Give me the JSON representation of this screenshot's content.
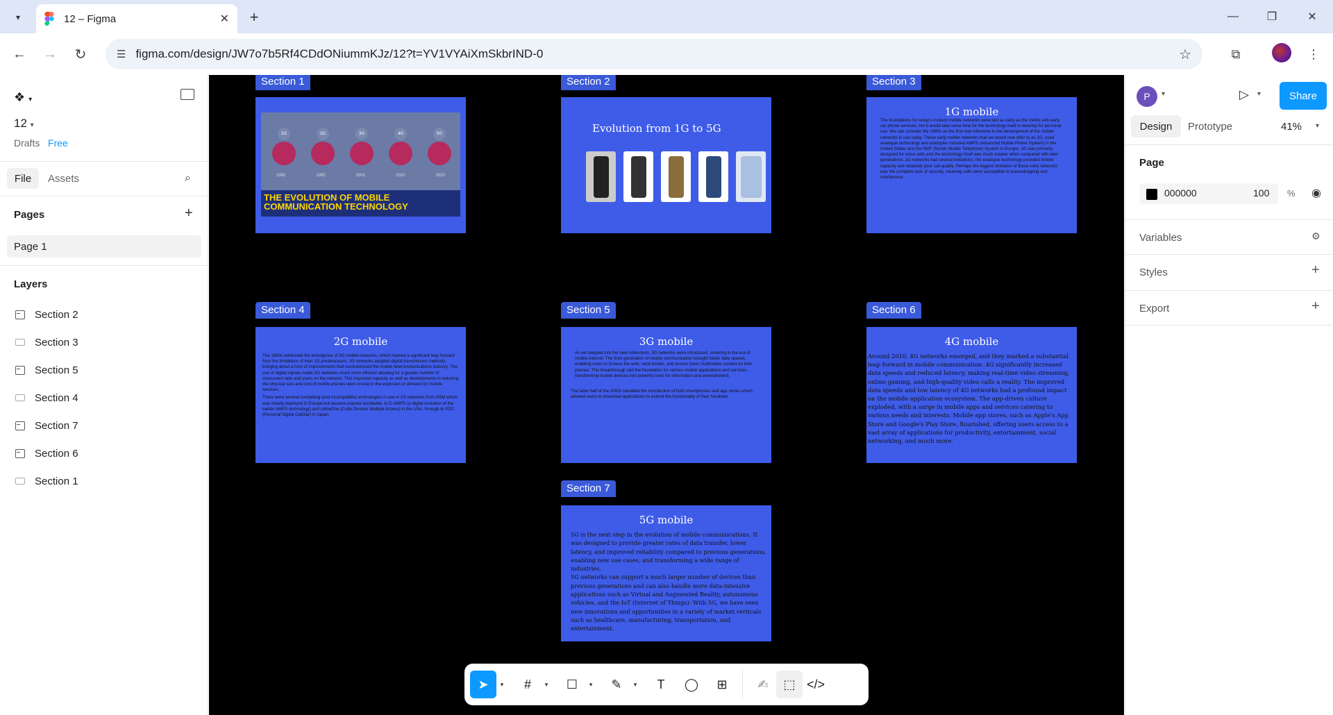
{
  "browser": {
    "tab_title": "12 – Figma",
    "url": "figma.com/design/JW7o7b5Rf4CDdONiummKJz/12?t=YV1VYAiXmSkbrIND-0"
  },
  "left_panel": {
    "file_name": "12",
    "drafts": "Drafts",
    "plan": "Free",
    "tabs": [
      "File",
      "Assets"
    ],
    "pages_heading": "Pages",
    "pages": [
      "Page 1"
    ],
    "layers_heading": "Layers",
    "layers": [
      "Section 2",
      "Section 3",
      "Section 5",
      "Section 4",
      "Section 7",
      "Section 6",
      "Section 1"
    ]
  },
  "canvas": {
    "sections": [
      {
        "label": "Section 1",
        "banner": "THE EVOLUTION OF MOBILE COMMUNICATION TECHNOLOGY",
        "generations": [
          "1G",
          "2G",
          "3G",
          "4G",
          "5G"
        ],
        "years": [
          "1982",
          "1992",
          "2001",
          "2010",
          "2020"
        ]
      },
      {
        "label": "Section 2",
        "title": "Evolution from 1G to 5G"
      },
      {
        "label": "Section 3",
        "title": "1G mobile",
        "body": "The foundations for today's modern mobile networks were laid as early as the 1940s with early car phone services, but it would take some time for the technology itself to develop for personal use. We can consider the 1980s as the first real milestone in the development of the mobile networks in use today. These early mobile networks that we would now refer to as 1G, used analogue technology and examples included AMPS (Advanced Mobile Phone System) in the United States and the NMT (Nordic Mobile Telephone) System in Europe. 1G was primarily designed for voice calls and the technology itself was much simpler when compared with later generations. 1G networks had several limitations, the analogue technology provided limited capacity and relatively poor call quality. Perhaps the biggest limitation of these early networks was the complete lack of security, meaning calls were susceptible to eavesdropping and interference."
      },
      {
        "label": "Section 4",
        "title": "2G mobile",
        "body": "The 1990s witnessed the emergence of 2G mobile networks, which marked a significant leap forward from the limitations of their 1G predecessors. 2G networks adopted digital transmission methods, bringing about a host of improvements that revolutionised the mobile telecommunications industry. The use of digital signals made 2G networks much more efficient allowing for a greater number of concurrent calls and users on the network. This improved capacity as well as developments in reducing the physical size and cost of mobile phones were crucial in the explosion of demand for mobile services.",
        "body2": "There were several competing (and incompatible) technologies in use in 2G networks from GSM which was initially deployed in Europe but became popular worldwide, to D-AMPS (a digital evolution of the earlier AMPS technology) and cdmaOne (Code Division Multiple Access) in the USA, through to PDC (Personal Digital Cellular) in Japan."
      },
      {
        "label": "Section 5",
        "title": "3G mobile",
        "body": "As we stepped into the new millennium, 3G networks were introduced, ushering in the era of mobile internet. The third generation of mobile communication brought faster data speeds, enabling users to browse the web, send emails, and access basic multimedia content on their phones. This breakthrough laid the foundation for various mobile applications and services, transforming mobile devices into powerful tools for information and entertainment.",
        "body2": "The latter half of the 2000s heralded the introduction of both smartphones and app stores which allowed users to download applications to extend the functionality of their handsets"
      },
      {
        "label": "Section 6",
        "title": "4G mobile",
        "body": "Around 2010, 4G networks emerged, and they marked a substantial leap forward in mobile communication. 4G significantly increased data speeds and reduced latency, making real-time video streaming, online gaming, and high-quality video calls a reality. The improved data speeds and low latency of 4G networks had a profound impact on the mobile application ecosystem. The app-driven culture exploded, with a surge in mobile apps and services catering to various needs and interests. Mobile app stores, such as Apple's App Store and Google's Play Store, flourished, offering users access to a vast array of applications for productivity, entertainment, social networking, and much more."
      },
      {
        "label": "Section 7",
        "title": "5G mobile",
        "body": "5G is the next step in the evolution of mobile communications. It was designed to provide greater rates of data transfer, lower latency, and improved reliability compared to previous generations, enabling new use cases, and transforming a wide range of industries.",
        "body2": "5G networks can support a much larger number of devices than previous generations and can also handle more data-intensive applications such as Virtual and Augmented Reality, autonomous vehicles, and the IoT (Internet of Things). With 5G, we have seen new innovations and opportunities in a variety of market verticals such as healthcare, manufacturing, transportation, and entertainment."
      }
    ]
  },
  "right_panel": {
    "user_initial": "P",
    "share": "Share",
    "tabs": [
      "Design",
      "Prototype"
    ],
    "zoom": "41%",
    "page_heading": "Page",
    "bg_color": "000000",
    "bg_opacity": "100",
    "percent": "%",
    "variables": "Variables",
    "styles": "Styles",
    "export": "Export"
  },
  "colors": {
    "accent": "#0d99ff",
    "section": "#3f5ce8",
    "canvas": "#000000"
  }
}
